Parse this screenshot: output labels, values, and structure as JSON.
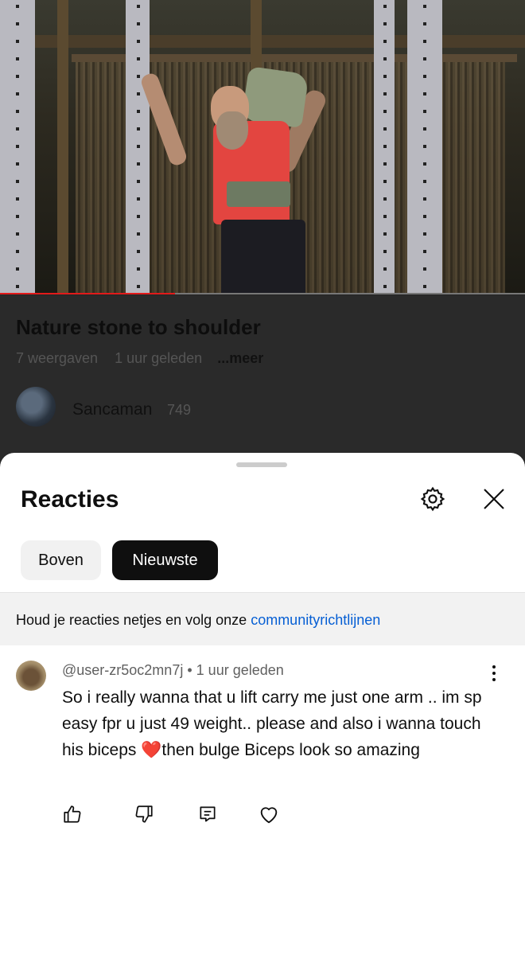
{
  "video": {
    "progress_fraction": 0.333,
    "title": "Nature stone to shoulder",
    "views": "7 weergaven",
    "age": "1 uur geleden",
    "more_label": "...meer",
    "channel_name": "Sancaman",
    "channel_subs": "749"
  },
  "comments_panel": {
    "title": "Reacties",
    "settings_icon": "gear-icon",
    "close_icon": "close-icon",
    "sort_chips": [
      {
        "label": "Boven",
        "selected": false
      },
      {
        "label": "Nieuwste",
        "selected": true
      }
    ],
    "guidelines_text": "Houd je reacties netjes en volg onze ",
    "guidelines_link": "communityrichtlijnen"
  },
  "comments": [
    {
      "author": "@user-zr5oc2mn7j",
      "separator": "•",
      "age": "1 uur geleden",
      "text_before": "So  i really wanna that u lift carry me just one arm .. im sp easy fpr u just 49 weight.. please and also i wanna touch his biceps ",
      "emoji": "❤️",
      "text_after": "then bulge Biceps look so amazing",
      "actions": [
        "thumbs-up-icon",
        "thumbs-down-icon",
        "reply-icon",
        "heart-icon"
      ]
    }
  ],
  "colors": {
    "accent_red": "#e21a1a",
    "link_blue": "#065fd4",
    "chip_selected_bg": "#0f0f0f"
  }
}
